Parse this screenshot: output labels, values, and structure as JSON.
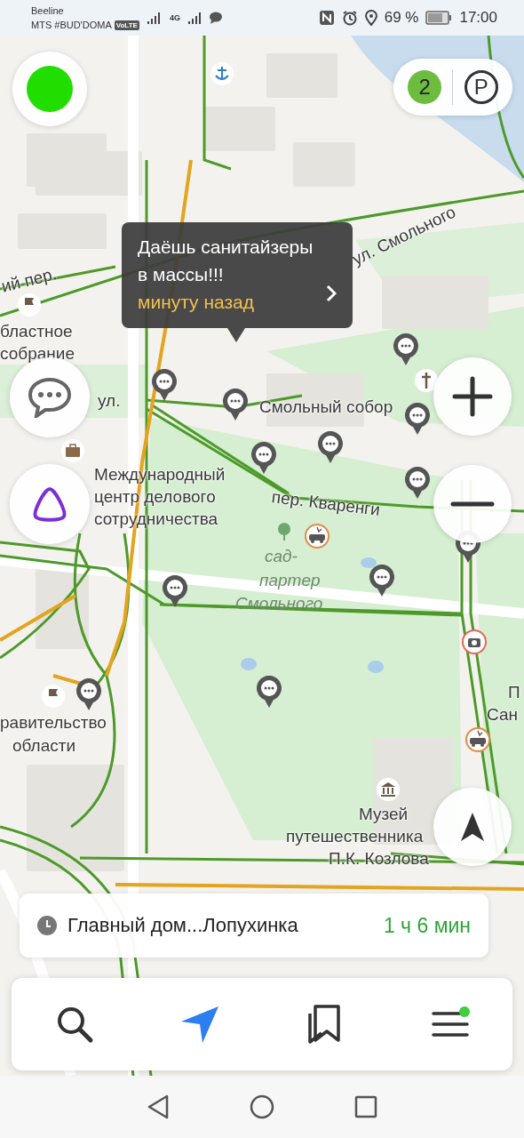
{
  "status_bar": {
    "carrier_1": "Beeline",
    "carrier_2": "MTS #BUD'DOMA",
    "volte": "VoLTE",
    "network": "4G",
    "battery": "69 %",
    "time": "17:00"
  },
  "map": {
    "labels": [
      {
        "text": "ий пер.",
        "kind": "street"
      },
      {
        "text": "ул. Смольного",
        "kind": "street"
      },
      {
        "text": "бластное",
        "kind": "place"
      },
      {
        "text": "собрание",
        "kind": "place"
      },
      {
        "text": "ул.",
        "kind": "street"
      },
      {
        "text": "Международный",
        "kind": "place"
      },
      {
        "text": "центр делового",
        "kind": "place"
      },
      {
        "text": "сотрудничества",
        "kind": "place"
      },
      {
        "text": "Смольный собор",
        "kind": "place"
      },
      {
        "text": "пер. Кваренги",
        "kind": "street"
      },
      {
        "text": "сад-",
        "kind": "park"
      },
      {
        "text": "партер",
        "kind": "park"
      },
      {
        "text": "Смольного",
        "kind": "park"
      },
      {
        "text": "равительство",
        "kind": "place"
      },
      {
        "text": "области",
        "kind": "place"
      },
      {
        "text": "П",
        "kind": "place"
      },
      {
        "text": "Сан",
        "kind": "place"
      },
      {
        "text": "Музей",
        "kind": "place"
      },
      {
        "text": "путешественника",
        "kind": "place"
      },
      {
        "text": "П.К. Козлова",
        "kind": "place"
      }
    ],
    "popup": {
      "message": "Даёшь санитайзеры в массы!!!",
      "time": "минуту назад"
    }
  },
  "traffic": {
    "level": "2",
    "parking": "P"
  },
  "route": {
    "title": "Главный дом...Лопухинка",
    "duration": "1 ч 6 мин"
  },
  "nav_tabs": [
    {
      "kind": "search",
      "selected": false,
      "notification": false
    },
    {
      "kind": "navigator",
      "selected": true,
      "notification": false
    },
    {
      "kind": "bookmarks",
      "selected": false,
      "notification": false
    },
    {
      "kind": "menu",
      "selected": false,
      "notification": true
    }
  ]
}
